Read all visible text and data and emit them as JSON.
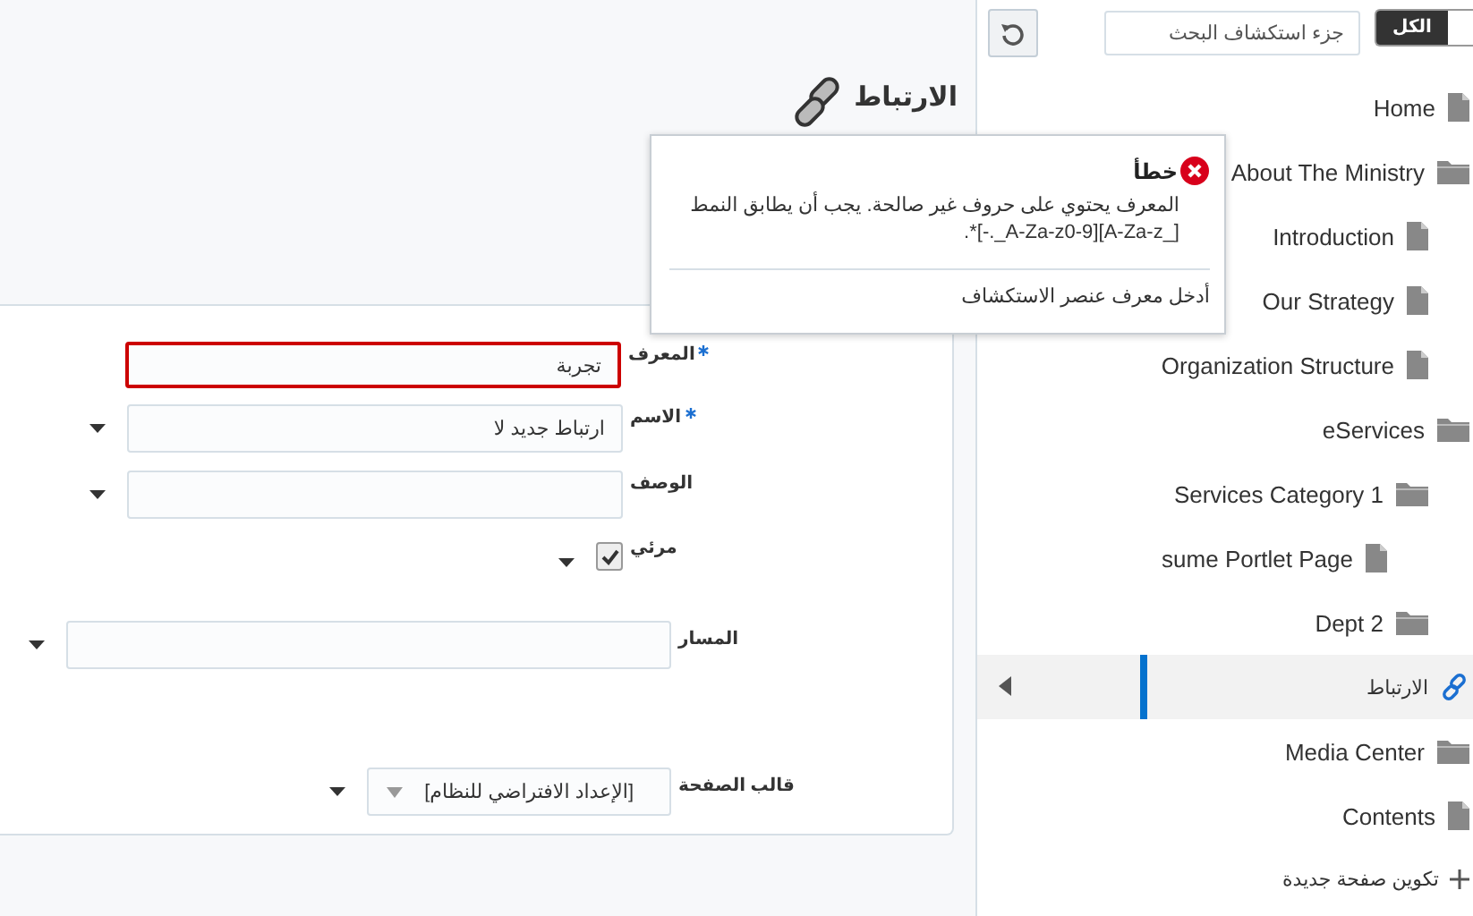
{
  "header": {
    "title": "الارتباط"
  },
  "form": {
    "fields": [
      {
        "kind": "text",
        "label": "المعرف",
        "required": true,
        "value": "تجربة",
        "invalid": true,
        "dropdown": false
      },
      {
        "kind": "text",
        "label": "الاسم",
        "required": true,
        "value": "ارتباط جديد لا",
        "invalid": false,
        "dropdown": true
      },
      {
        "kind": "text",
        "label": "الوصف",
        "required": false,
        "invalid": false,
        "dropdown": true
      },
      {
        "kind": "checkbox",
        "label": "مرئي",
        "required": false,
        "checked": true,
        "dropdown": true
      },
      {
        "kind": "text",
        "label": "المسار",
        "required": false,
        "invalid": false,
        "dropdown": true
      },
      {
        "kind": "select",
        "label": "قالب الصفحة",
        "required": false,
        "value": "[الإعداد الافتراضي للنظام]",
        "dropdown": true
      }
    ]
  },
  "error_popup": {
    "title": "خطأ",
    "message": "المعرف يحتوي على حروف غير صالحة. يجب أن يطابق النمط [_A-Za-z][A-Za-z0-9_.-]*.",
    "hint": "أدخل معرف عنصر الاستكشاف"
  },
  "navigator": {
    "scope_toggle": {
      "label": "الكل",
      "selected": true
    },
    "search": {
      "placeholder": "جزء استكشاف البحث"
    },
    "tree": [
      {
        "label": "Home",
        "kind": "page",
        "selected": false
      },
      {
        "label": "About The Ministry",
        "kind": "folder",
        "selected": false,
        "children": [
          {
            "label": "Introduction",
            "kind": "page",
            "selected": false
          },
          {
            "label": "Our Strategy",
            "kind": "page",
            "selected": false
          },
          {
            "label": "Organization Structure",
            "kind": "page",
            "selected": false
          }
        ]
      },
      {
        "label": "eServices",
        "kind": "folder",
        "selected": false,
        "children": [
          {
            "label": "Services Category 1",
            "kind": "folder",
            "selected": false,
            "children": [
              {
                "label": "sume Portlet Page",
                "kind": "page",
                "selected": false
              }
            ]
          },
          {
            "label": "Dept 2",
            "kind": "folder",
            "selected": false
          }
        ]
      },
      {
        "label": "الارتباط",
        "kind": "link",
        "selected": true
      },
      {
        "label": "Media Center",
        "kind": "folder",
        "selected": false
      },
      {
        "label": "Contents",
        "kind": "page",
        "selected": false
      }
    ],
    "create_link": "تكوين صفحة جديدة"
  }
}
